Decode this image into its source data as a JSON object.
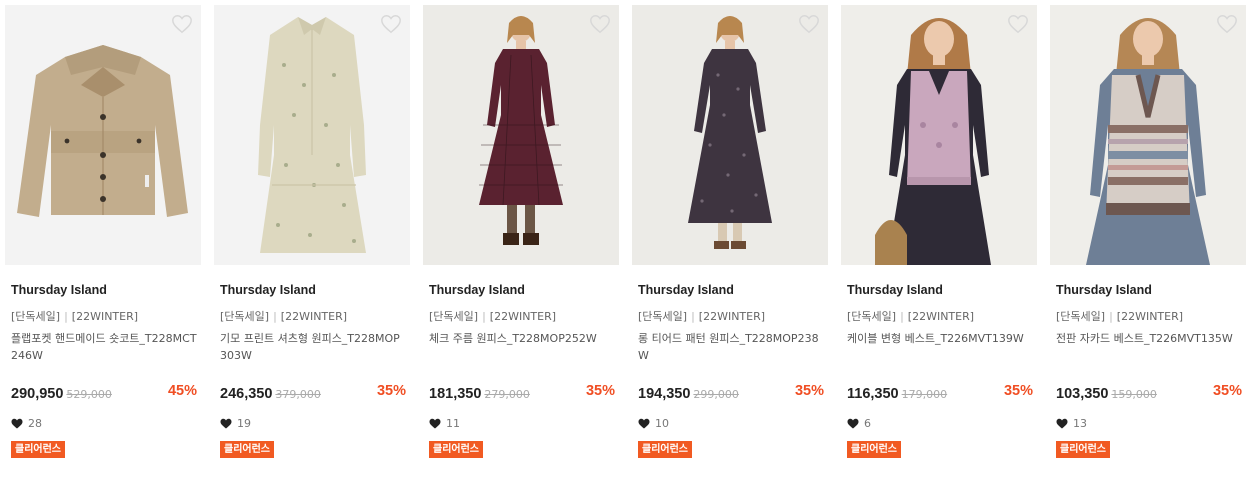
{
  "colors": {
    "accent": "#f04e23",
    "badge": "#f15a22"
  },
  "products": [
    {
      "brand": "Thursday Island",
      "tag1": "[단독세일]",
      "tag2": "[22WINTER]",
      "name": "플랩포켓 핸드메이드 숏코트_T228MCT246W",
      "price": "290,950",
      "original": "529,000",
      "discount": "45%",
      "likes": "28",
      "badge": "클리어런스"
    },
    {
      "brand": "Thursday Island",
      "tag1": "[단독세일]",
      "tag2": "[22WINTER]",
      "name": "기모 프린트 셔츠형 원피스_T228MOP303W",
      "price": "246,350",
      "original": "379,000",
      "discount": "35%",
      "likes": "19",
      "badge": "클리어런스"
    },
    {
      "brand": "Thursday Island",
      "tag1": "[단독세일]",
      "tag2": "[22WINTER]",
      "name": "체크 주름 원피스_T228MOP252W",
      "price": "181,350",
      "original": "279,000",
      "discount": "35%",
      "likes": "11",
      "badge": "클리어런스"
    },
    {
      "brand": "Thursday Island",
      "tag1": "[단독세일]",
      "tag2": "[22WINTER]",
      "name": "롱 티어드 패턴 원피스_T228MOP238W",
      "price": "194,350",
      "original": "299,000",
      "discount": "35%",
      "likes": "10",
      "badge": "클리어런스"
    },
    {
      "brand": "Thursday Island",
      "tag1": "[단독세일]",
      "tag2": "[22WINTER]",
      "name": "케이블 변형 베스트_T226MVT139W",
      "price": "116,350",
      "original": "179,000",
      "discount": "35%",
      "likes": "6",
      "badge": "클리어런스"
    },
    {
      "brand": "Thursday Island",
      "tag1": "[단독세일]",
      "tag2": "[22WINTER]",
      "name": "전판 자카드 베스트_T226MVT135W",
      "price": "103,350",
      "original": "159,000",
      "discount": "35%",
      "likes": "13",
      "badge": "클리어런스"
    }
  ]
}
